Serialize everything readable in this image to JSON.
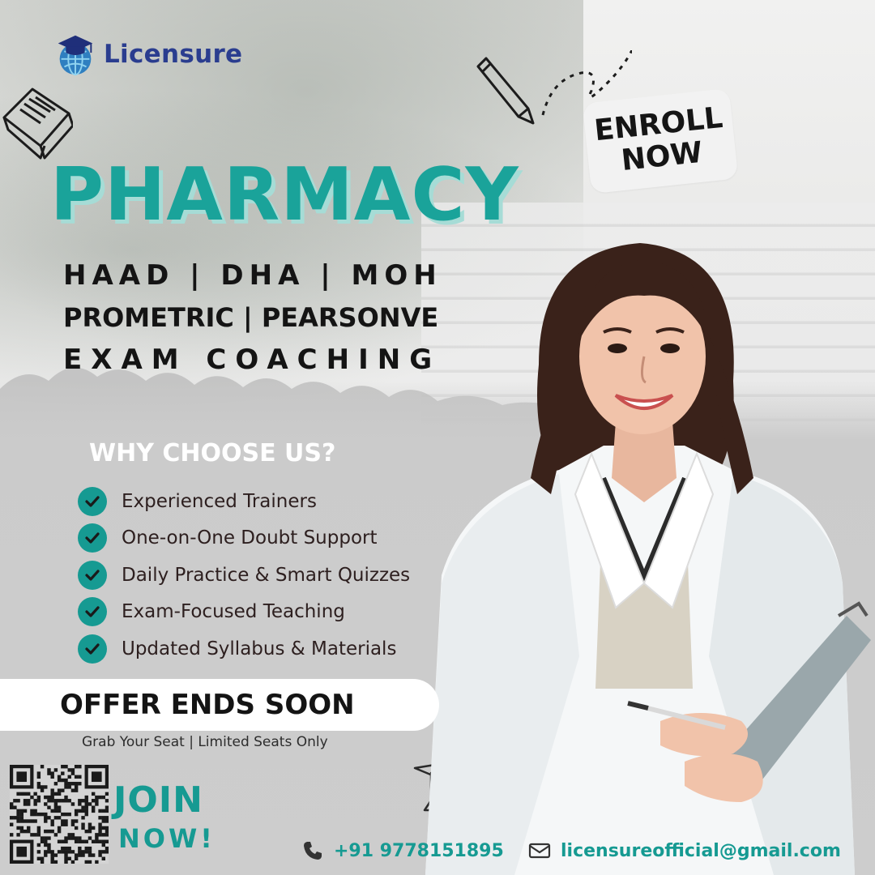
{
  "brand": {
    "name": "Licensure"
  },
  "enroll": {
    "line1": "ENROLL",
    "line2": "NOW"
  },
  "headline": "PHARMACY",
  "subtitles": {
    "line1": "HAAD | DHA | MOH",
    "line2": "PROMETRIC | PEARSONVE",
    "line3": "EXAM COACHING"
  },
  "why": {
    "title": "WHY CHOOSE US?",
    "items": [
      "Experienced Trainers",
      "One-on-One Doubt Support",
      "Daily Practice & Smart Quizzes",
      "Exam-Focused Teaching",
      "Updated Syllabus & Materials"
    ]
  },
  "offer": {
    "title": "OFFER ENDS SOON",
    "subtitle": "Grab Your Seat | Limited Seats Only"
  },
  "join": {
    "line1": "JOIN",
    "line2": "NOW!"
  },
  "contact": {
    "phone": "+91 9778151895",
    "email": "licensureofficial@gmail.com"
  },
  "icons": {
    "logo": "graduation-globe-icon",
    "book": "open-book-icon",
    "pencil": "pencil-icon",
    "cap": "graduation-cap-icon",
    "check": "check-icon",
    "phone": "phone-icon",
    "email": "envelope-icon",
    "qr": "qr-code"
  },
  "colors": {
    "teal": "#169a92",
    "headline": "#1aa39a",
    "brand": "#2a3d8f",
    "text": "#141414"
  }
}
